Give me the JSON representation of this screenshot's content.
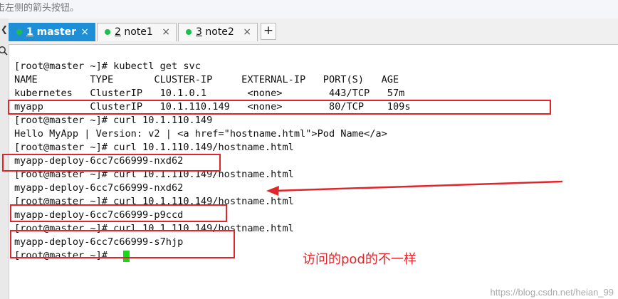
{
  "hint": {
    "text": "击左侧的箭头按钮。"
  },
  "gutter": {
    "arrow_icon": "chevron-left-icon",
    "search_icon": "search-icon"
  },
  "tabs": [
    {
      "number": "1",
      "name": "master",
      "label": "1 master",
      "active": true,
      "status_color": "#19c04a"
    },
    {
      "number": "2",
      "name": "note1",
      "label": "2 note1",
      "active": false,
      "status_color": "#19c04a"
    },
    {
      "number": "3",
      "name": "note2",
      "label": "3 note2",
      "active": false,
      "status_color": "#19c04a"
    }
  ],
  "tab_close_glyph": "×",
  "new_tab_label": "+",
  "terminal": {
    "lines": [
      "[root@master ~]# kubectl get svc",
      "NAME         TYPE       CLUSTER-IP     EXTERNAL-IP   PORT(S)   AGE",
      "kubernetes   ClusterIP   10.1.0.1       <none>        443/TCP   57m",
      "myapp        ClusterIP   10.1.110.149   <none>        80/TCP    109s",
      "[root@master ~]# curl 10.1.110.149",
      "Hello MyApp | Version: v2 | <a href=\"hostname.html\">Pod Name</a>",
      "[root@master ~]# curl 10.1.110.149/hostname.html",
      "myapp-deploy-6cc7c66999-nxd62",
      "[root@master ~]# curl 10.1.110.149/hostname.html",
      "myapp-deploy-6cc7c66999-nxd62",
      "[root@master ~]# curl 10.1.110.149/hostname.html",
      "myapp-deploy-6cc7c66999-p9ccd",
      "[root@master ~]# curl 10.1.110.149/hostname.html",
      "myapp-deploy-6cc7c66999-s7hjp",
      "[root@master ~]# "
    ],
    "cursor_color": "#18d818"
  },
  "annotation": {
    "text": "访问的pod的不一样",
    "color": "#e0262b"
  },
  "watermark": "https://blog.csdn.net/heian_99"
}
